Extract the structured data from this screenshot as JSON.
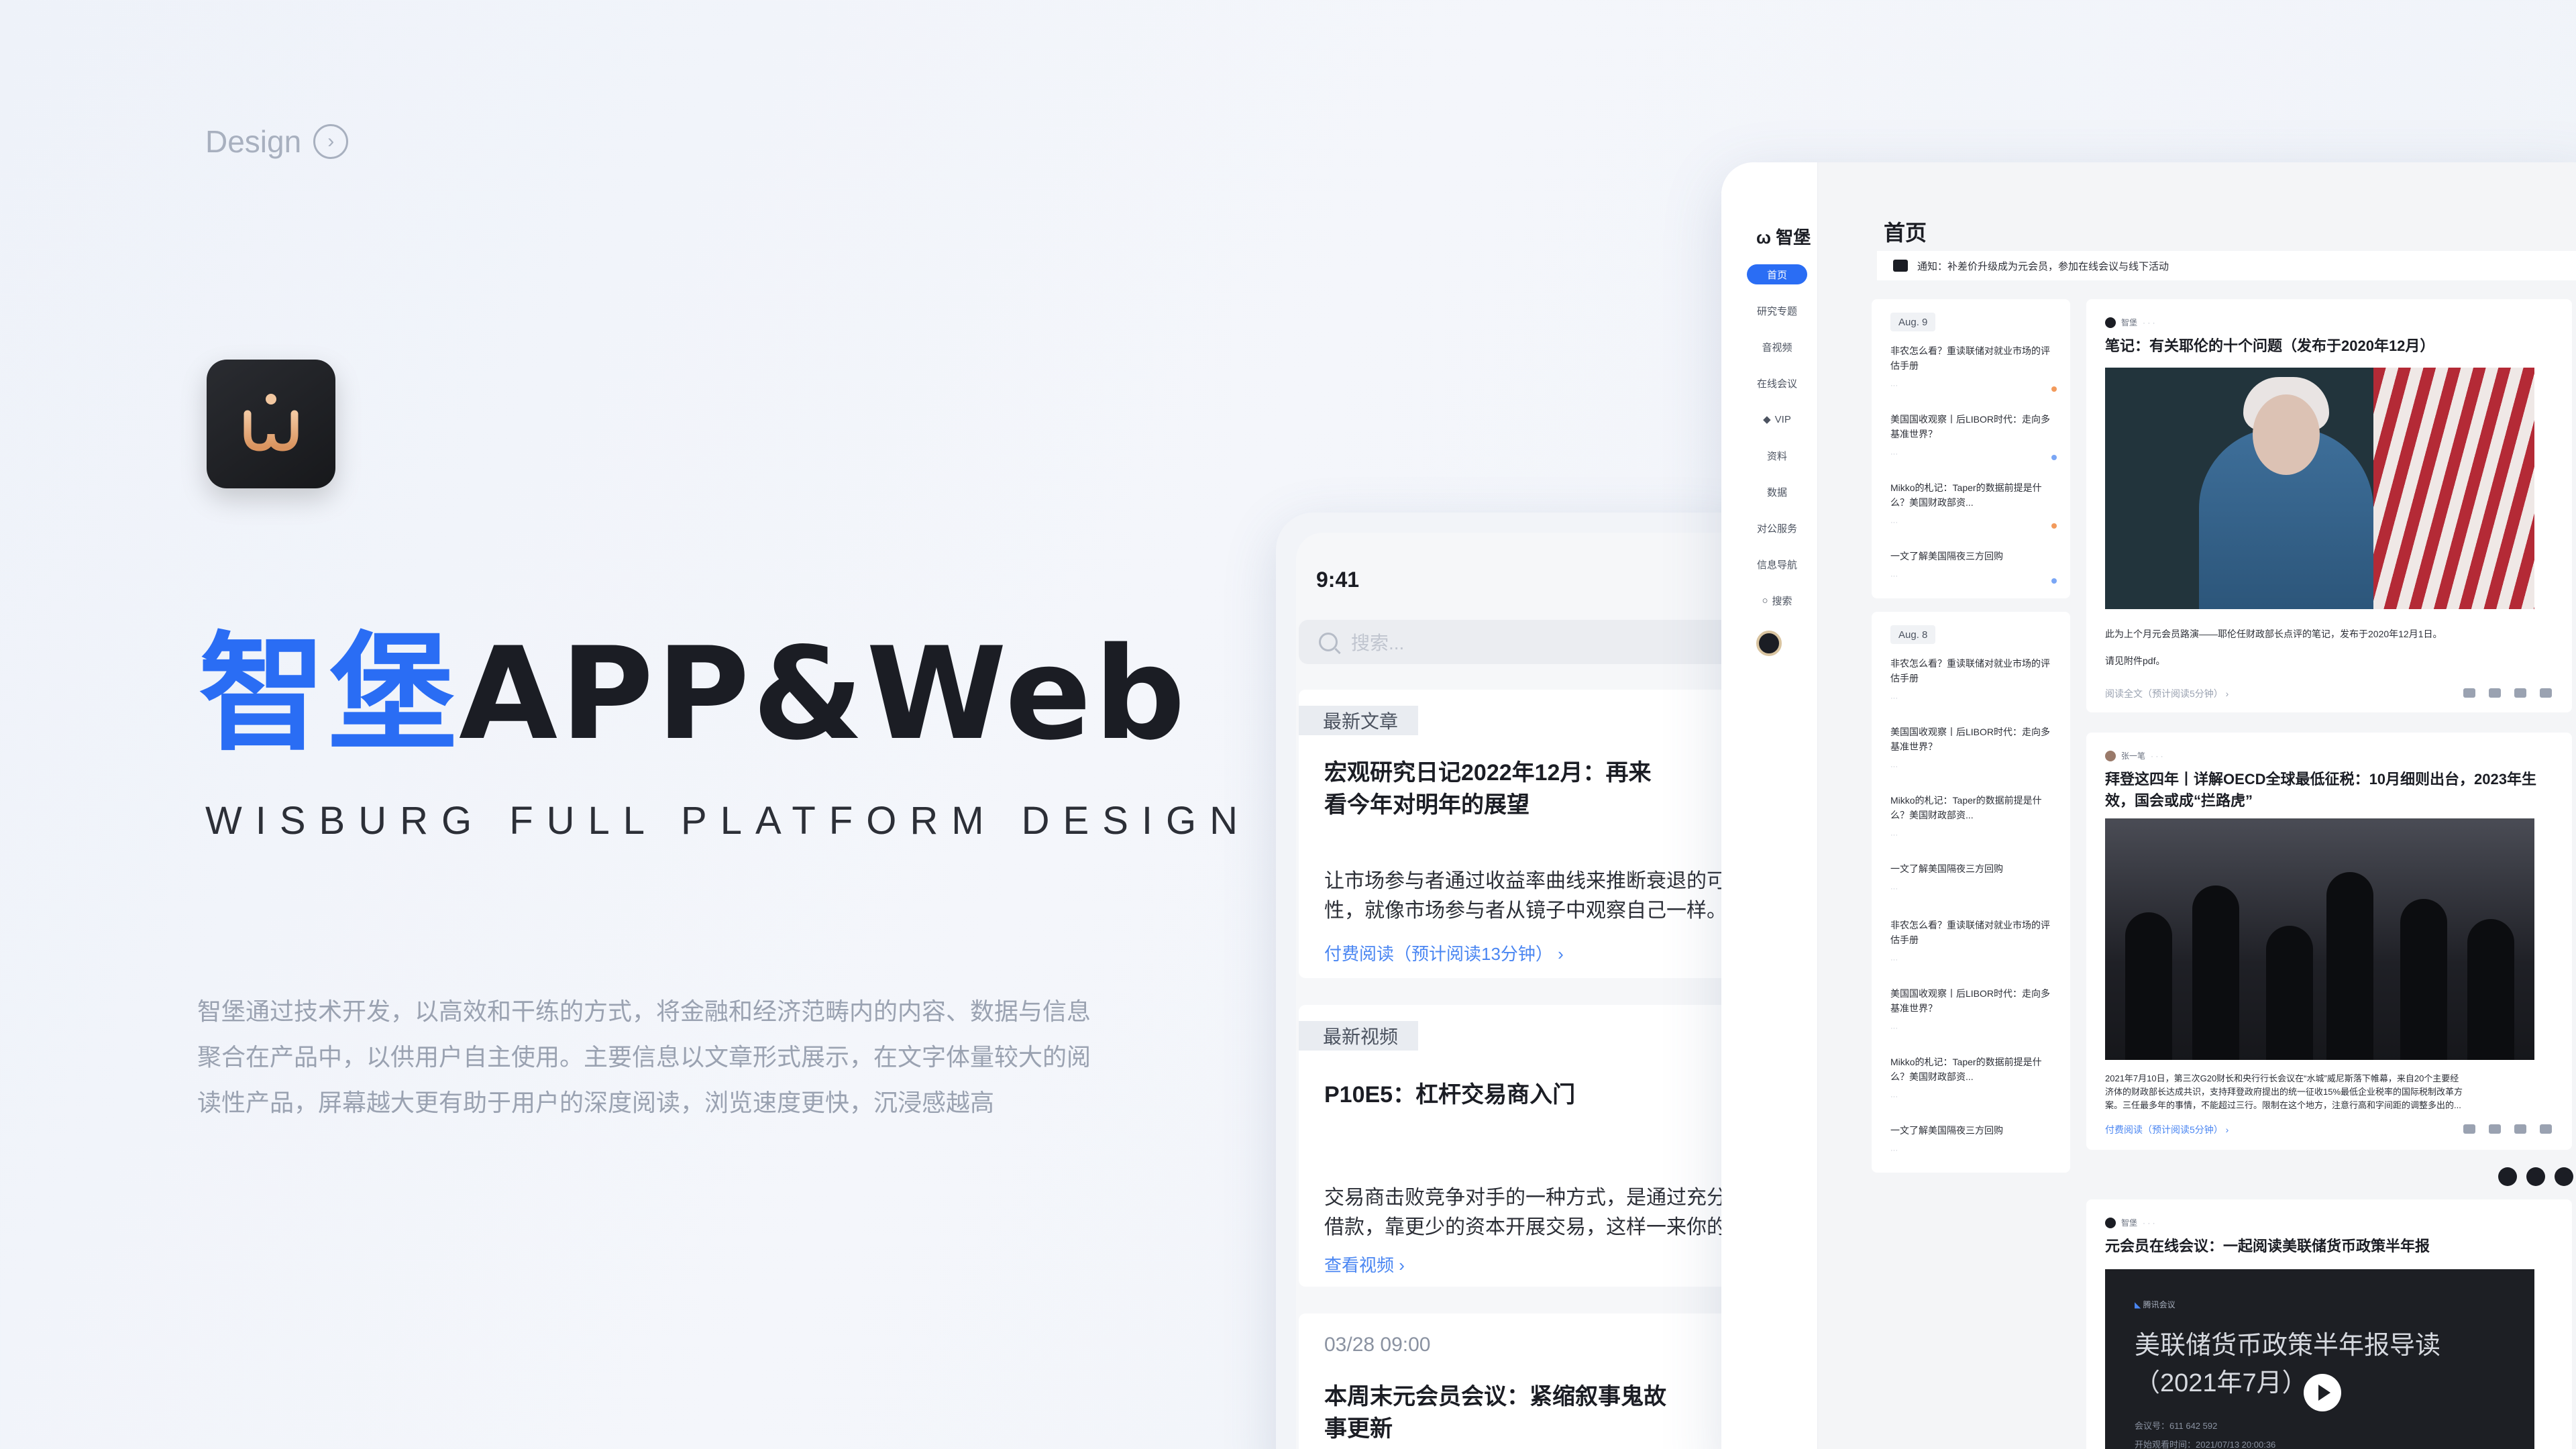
{
  "design_link": {
    "label": "Design",
    "icon": "chevron-right-circle-icon"
  },
  "hero": {
    "title_cn": "智堡",
    "title_en": "APP&Web",
    "subtitle": "WISBURG FULL PLATFORM DESIGN",
    "description_lines": [
      "智堡通过技术开发，以高效和干练的方式，将金融和经济范畴内的内容、数据与信息",
      "聚合在产品中，以供用户自主使用。主要信息以文章形式展示，在文字体量较大的阅",
      "读性产品，屏幕越大更有助于用户的深度阅读，浏览速度更快，沉浸感越高"
    ]
  },
  "colors": {
    "brand_blue": "#2a6df4",
    "link_blue": "#4a86f2",
    "dark": "#1b1d24"
  },
  "phone": {
    "time": "9:41",
    "search_placeholder": "搜索...",
    "cards": [
      {
        "tag": "最新文章",
        "title": "宏观研究日记2022年12月：再来看今年对明年的展望",
        "text_lines": [
          "让市场参与者通过收益率曲线来推断衰退的可",
          "性，就像市场参与者从镜子中观察自己一样。"
        ],
        "link": "付费阅读（预计阅读13分钟）"
      },
      {
        "tag": "最新视频",
        "title": "P10E5：杠杆交易商入门",
        "text_lines": [
          "交易商击败竞争对手的一种方式，是通过充分",
          "借款，靠更少的资本开展交易，这样一来你的"
        ],
        "link": "查看视频"
      },
      {
        "date": "03/28 09:00",
        "title": "本周末元会员会议：紧缩叙事鬼故事更新"
      }
    ]
  },
  "web": {
    "logo": "智堡",
    "nav": [
      "首页",
      "研究专题",
      "音视频",
      "在线会议",
      "VIP",
      "资料",
      "数据",
      "对公服务",
      "信息导航",
      "搜索"
    ],
    "page_title": "首页",
    "notice": "通知：补差价升级成为元会员，参加在线会议与线下活动",
    "list_groups": [
      {
        "date": "Aug. 9",
        "items": [
          "非农怎么看？重读联储对就业市场的评估手册",
          "美国国收观察丨后LIBOR时代：走向多基准世界？",
          "Mikko的札记：Taper的数据前提是什么？美国财政部资...",
          "一文了解美国隔夜三方回购"
        ]
      },
      {
        "date": "Aug. 8",
        "items": [
          "非农怎么看？重读联储对就业市场的评估手册",
          "美国国收观察丨后LIBOR时代：走向多基准世界？",
          "Mikko的札记：Taper的数据前提是什么？美国财政部资...",
          "一文了解美国隔夜三方回购",
          "非农怎么看？重读联储对就业市场的评估手册",
          "美国国收观察丨后LIBOR时代：走向多基准世界？",
          "Mikko的札记：Taper的数据前提是什么？美国财政部资...",
          "一文了解美国隔夜三方回购"
        ]
      }
    ],
    "articles": [
      {
        "author": "智堡",
        "title": "笔记：有关耶伦的十个问题（发布于2020年12月）",
        "text_lines": [
          "此为上个月元会员路演——耶伦任财政部长点评的笔记，发布于2020年12月1日。",
          "请见附件pdf。"
        ],
        "link": "阅读全文（预计阅读5分钟）"
      },
      {
        "author": "张一笔",
        "title": "拜登这四年丨详解OECD全球最低征税：10月细则出台，2023年生效，国会或成“拦路虎”",
        "text_lines": [
          "2021年7月10日，第三次G20财长和央行行长会议在“水城”威尼斯落下帷幕，来自20个主要经",
          "济体的财政部长达成共识，支持拜登政府提出的统一征收15%最低企业税率的国际税制改革方",
          "案。三任最多年的事情，不能超过三行。限制在这个地方，注意行高和字间距的调整多出的..."
        ],
        "link": "付费阅读（预计阅读5分钟）"
      },
      {
        "author": "智堡",
        "title": "元会员在线会议：一起阅读美联储货币政策半年报",
        "video_brand": "腾讯会议",
        "video_title": "美联储货币政策半年报导读（2021年7月）",
        "video_meta": [
          "会议号：611 642 592",
          "开始观看时间：2021/07/13 20:00:36"
        ]
      }
    ]
  }
}
